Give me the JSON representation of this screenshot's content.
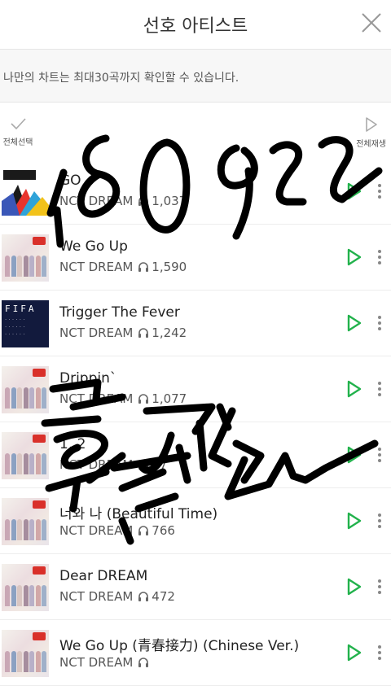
{
  "header": {
    "title": "선호 아티스트",
    "close_icon": "close-icon"
  },
  "notice": "나만의 차트는 최대30곡까지 확인할 수 있습니다.",
  "toolbar": {
    "select_all_label": "전체선택",
    "play_all_label": "전체재생"
  },
  "accent_color": "#22b24c",
  "songs": [
    {
      "title": "GO",
      "artist": "NCT DREAM",
      "plays": "1,037",
      "cover": "go-cover"
    },
    {
      "title": "We Go Up",
      "artist": "NCT DREAM",
      "plays": "1,590",
      "cover": "we-go-up-cover"
    },
    {
      "title": "Trigger The Fever",
      "artist": "NCT DREAM",
      "plays": "1,242",
      "cover": "fifa-cover"
    },
    {
      "title": "Drippin`",
      "artist": "NCT DREAM",
      "plays": "1,077",
      "cover": "we-go-up-cover"
    },
    {
      "title": "1, 2",
      "artist": "NCT DREAM",
      "plays": "77",
      "cover": "we-go-up-cover"
    },
    {
      "title": "너와 나 (Beautiful Time)",
      "artist": "NCT DREAM",
      "plays": "766",
      "cover": "we-go-up-cover"
    },
    {
      "title": "Dear DREAM",
      "artist": "NCT DREAM",
      "plays": "472",
      "cover": "we-go-up-cover"
    },
    {
      "title": "We Go Up (青春接力) (Chinese Ver.)",
      "artist": "NCT DREAM",
      "plays": "",
      "cover": "we-go-up-cover"
    }
  ],
  "handwriting": {
    "top": "180922",
    "bottom": "토셀파"
  }
}
